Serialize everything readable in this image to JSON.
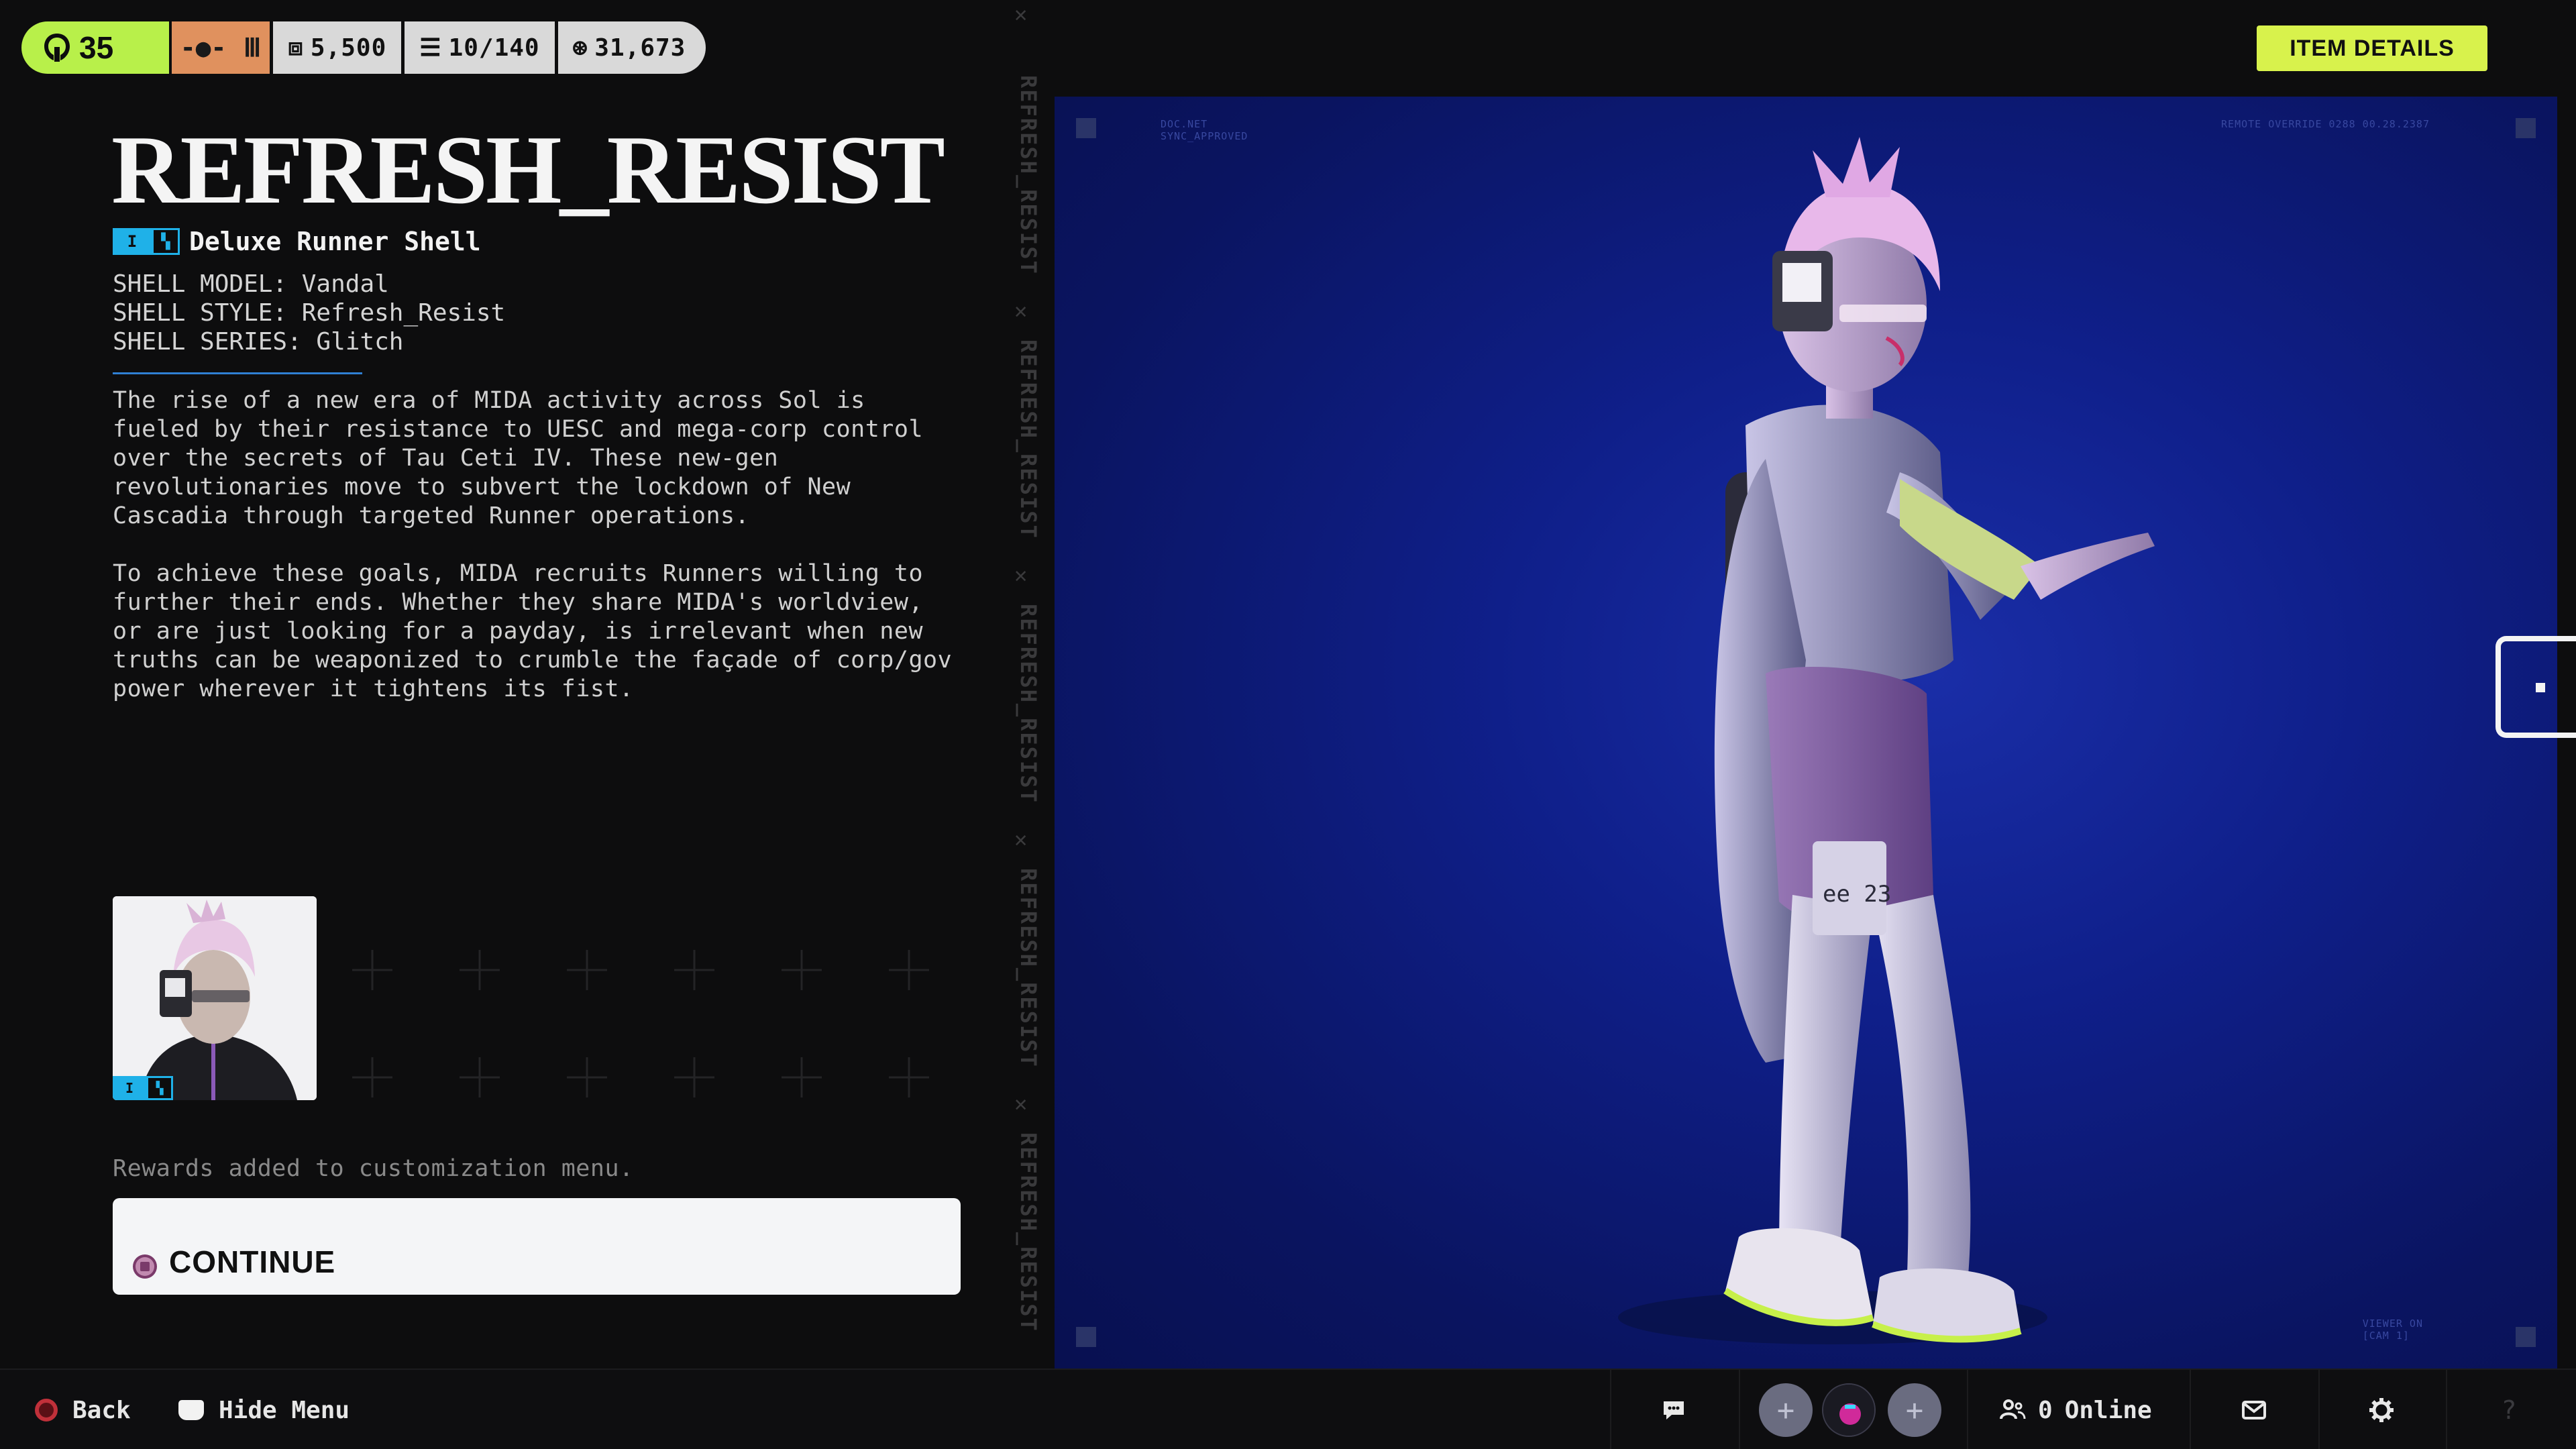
{
  "topbar": {
    "level": "35",
    "stats": [
      {
        "icon": "ticket-icon",
        "value": "5,500"
      },
      {
        "icon": "layers-icon",
        "value": "10/140"
      },
      {
        "icon": "coin-icon",
        "value": "31,673"
      }
    ]
  },
  "item": {
    "title": "REFRESH_RESIST",
    "tier_label": "I",
    "subtitle": "Deluxe Runner Shell",
    "specs": [
      "SHELL MODEL: Vandal",
      "SHELL STYLE: Refresh_Resist",
      "SHELL SERIES: Glitch"
    ],
    "description": [
      "The rise of a new era of MIDA activity across Sol is fueled by their resistance to UESC and mega-corp control over the secrets of Tau Ceti IV. These new-gen revolutionaries move to subvert the lockdown of New Cascadia through targeted Runner operations.",
      "To achieve these goals, MIDA recruits Runners willing to further their ends. Whether they share MIDA's worldview, or are just looking for a payday, is irrelevant when new truths can be weaponized to crumble the façade of corp/gov power wherever it tightens its fist."
    ]
  },
  "rewards_note": "Rewards added to customization menu.",
  "continue_label": "CONTINUE",
  "item_details_label": "ITEM DETAILS",
  "strip_label": "REFRESH_RESIST",
  "viewport_labels": {
    "top_left": "DOC.NET\nSYNC_APPROVED",
    "top_right": "REMOTE OVERRIDE 0288 00.28.2387",
    "bottom_right": "VIEWER ON\n[CAM 1]",
    "leg_tag": "ee 23"
  },
  "bottombar": {
    "back_label": "Back",
    "hide_menu_label": "Hide Menu",
    "online_count": "0",
    "online_label": "Online"
  },
  "colors": {
    "level_green": "#b8f04a",
    "rank_orange": "#e0915e",
    "accent_blue": "#1fb1e8",
    "item_details_yellow": "#d8f24c",
    "viewport_blue": "#0f1f8a"
  }
}
